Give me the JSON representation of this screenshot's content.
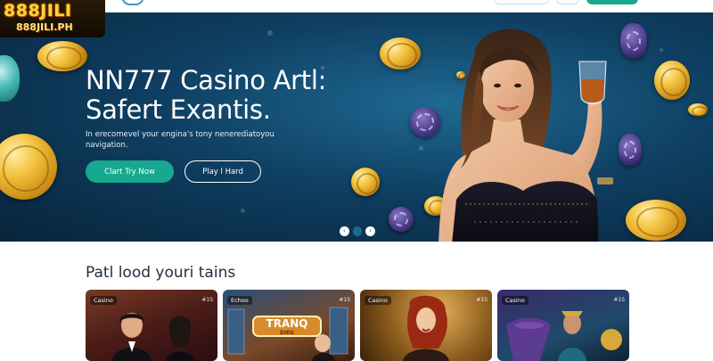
{
  "logo": {
    "main": "888JILI",
    "sub": "888JILI.PH"
  },
  "colors": {
    "accent": "#17a88f",
    "hero_bg": "#0f3f62",
    "title_text": "#1f2d3d"
  },
  "header": {
    "icons": [
      "menu-icon"
    ]
  },
  "hero": {
    "title_line1": "NN777 Casino Artl:",
    "title_line2": "Safert Exantis.",
    "subtitle_line1": "In erecomevel your engina's tony nenerediatoyou",
    "subtitle_line2": "navigation.",
    "primary_button": "Clart Try Now",
    "secondary_button": "Play l Hard",
    "carousel": {
      "prev": "‹",
      "next": "›"
    }
  },
  "section": {
    "title": "Patl lood youri tains",
    "cards": [
      {
        "tag": "Casino",
        "badge": "#1S"
      },
      {
        "tag": "Echoo",
        "badge": "#1S",
        "sign_line1": "TRANQ",
        "sign_line2": "DIEG"
      },
      {
        "tag": "Casino",
        "badge": "#1S"
      },
      {
        "tag": "Casino",
        "badge": "#1S"
      }
    ]
  }
}
